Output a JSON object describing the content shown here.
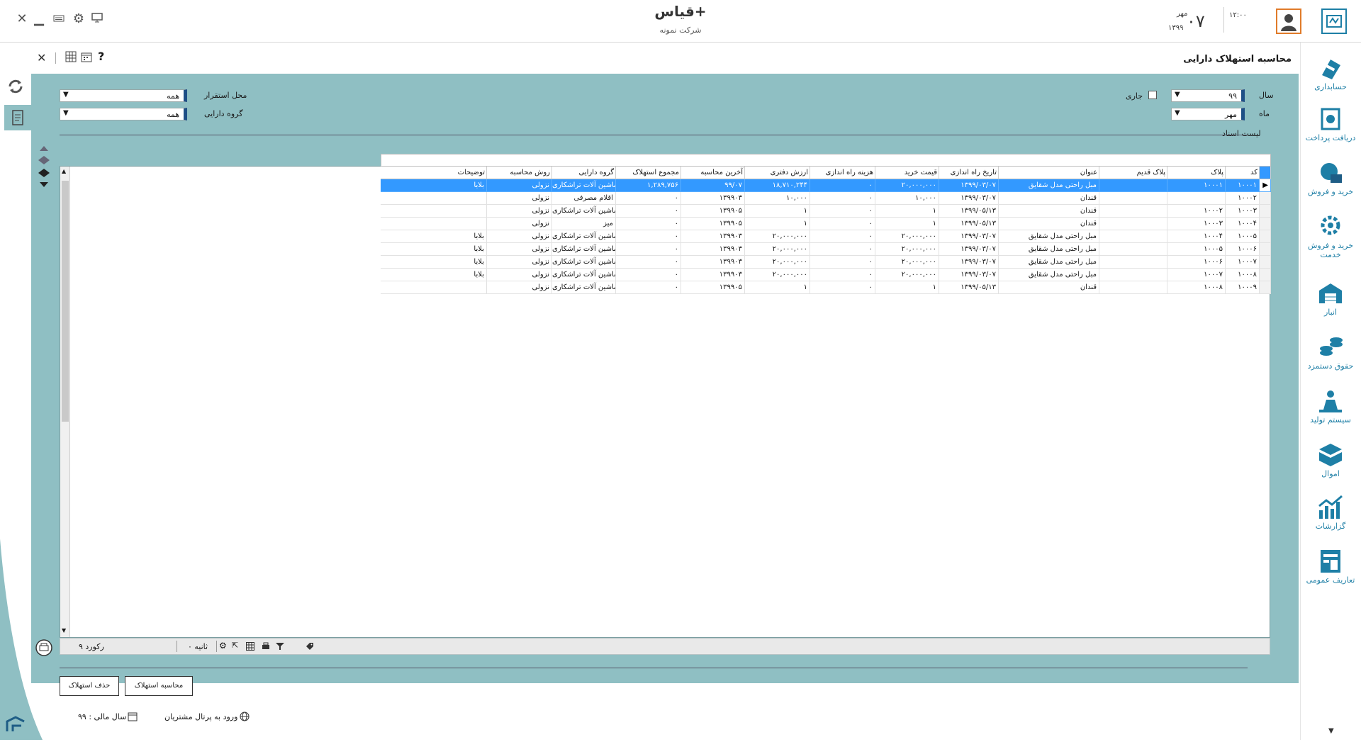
{
  "header": {
    "app_title": "قیاس+",
    "company": "شرکت نمونه",
    "time": "۱۲:۰۰",
    "day": "۰۷",
    "month": "مهر",
    "year": "۱۳۹۹"
  },
  "page": {
    "title": "محاسبه استهلاک دارایی",
    "help": "?"
  },
  "filters": {
    "year_label": "سال",
    "year_value": "۹۹",
    "current_label": "جاری",
    "month_label": "ماه",
    "month_value": "مهر",
    "location_label": "محل استقرار",
    "location_value": "همه",
    "group_label": "گروه دارایی",
    "group_value": "همه",
    "list_title": "لیست اسناد"
  },
  "nav": [
    {
      "label": "حسابداری",
      "icon": "accounting-icon"
    },
    {
      "label": "دریافت پرداخت",
      "icon": "payment-icon"
    },
    {
      "label": "خرید و فروش",
      "icon": "sales-icon"
    },
    {
      "label": "خرید و فروش خدمت",
      "icon": "service-icon"
    },
    {
      "label": "انبار",
      "icon": "warehouse-icon"
    },
    {
      "label": "حقوق دستمزد",
      "icon": "payroll-icon"
    },
    {
      "label": "سیستم تولید",
      "icon": "production-icon"
    },
    {
      "label": "اموال",
      "icon": "assets-icon"
    },
    {
      "label": "گزارشات",
      "icon": "reports-icon"
    },
    {
      "label": "تعاریف عمومی",
      "icon": "definitions-icon"
    }
  ],
  "table": {
    "columns": [
      "کد",
      "پلاک",
      "پلاک قدیم",
      "عنوان",
      "تاریخ راه اندازی",
      "قیمت خرید",
      "هزینه راه اندازی",
      "ارزش دفتری",
      "آخرین محاسبه",
      "مجموع استهلاک",
      "گروه دارایی",
      "روش محاسبه",
      "توضیحات"
    ],
    "rows": [
      [
        "۱۰۰۰۱",
        "۱۰۰۰۱",
        "",
        "مبل راحتی مدل شقایق",
        "۱۳۹۹/۰۳/۰۷",
        "۲۰,۰۰۰,۰۰۰",
        "۰",
        "۱۸,۷۱۰,۲۴۴",
        "۹۹/۰۷",
        "۱,۲۸۹,۷۵۶",
        "ماشین آلات تراشکاری",
        "نزولی",
        "بلابا"
      ],
      [
        "۱۰۰۰۲",
        "",
        "",
        "قندان",
        "۱۳۹۹/۰۳/۰۷",
        "۱۰,۰۰۰",
        "۰",
        "۱۰,۰۰۰",
        "۱۳۹۹۰۳",
        "۰",
        "اقلام مصرفی",
        "نزولی",
        ""
      ],
      [
        "۱۰۰۰۳",
        "۱۰۰۰۲",
        "",
        "قندان",
        "۱۳۹۹/۰۵/۱۳",
        "۱",
        "۰",
        "۱",
        "۱۳۹۹۰۵",
        "۰",
        "ماشین آلات تراشکاری",
        "نزولی",
        ""
      ],
      [
        "۱۰۰۰۴",
        "۱۰۰۰۳",
        "",
        "قندان",
        "۱۳۹۹/۰۵/۱۳",
        "۱",
        "۰",
        "۱",
        "۱۳۹۹۰۵",
        "۰",
        "میز",
        "نزولی",
        ""
      ],
      [
        "۱۰۰۰۵",
        "۱۰۰۰۴",
        "",
        "مبل راحتی مدل شقایق",
        "۱۳۹۹/۰۳/۰۷",
        "۲۰,۰۰۰,۰۰۰",
        "۰",
        "۲۰,۰۰۰,۰۰۰",
        "۱۳۹۹۰۳",
        "۰",
        "ماشین آلات تراشکاری",
        "نزولی",
        "بلابا"
      ],
      [
        "۱۰۰۰۶",
        "۱۰۰۰۵",
        "",
        "مبل راحتی مدل شقایق",
        "۱۳۹۹/۰۳/۰۷",
        "۲۰,۰۰۰,۰۰۰",
        "۰",
        "۲۰,۰۰۰,۰۰۰",
        "۱۳۹۹۰۳",
        "۰",
        "ماشین آلات تراشکاری",
        "نزولی",
        "بلابا"
      ],
      [
        "۱۰۰۰۷",
        "۱۰۰۰۶",
        "",
        "مبل راحتی مدل شقایق",
        "۱۳۹۹/۰۳/۰۷",
        "۲۰,۰۰۰,۰۰۰",
        "۰",
        "۲۰,۰۰۰,۰۰۰",
        "۱۳۹۹۰۳",
        "۰",
        "ماشین آلات تراشکاری",
        "نزولی",
        "بلابا"
      ],
      [
        "۱۰۰۰۸",
        "۱۰۰۰۷",
        "",
        "مبل راحتی مدل شقایق",
        "۱۳۹۹/۰۳/۰۷",
        "۲۰,۰۰۰,۰۰۰",
        "۰",
        "۲۰,۰۰۰,۰۰۰",
        "۱۳۹۹۰۳",
        "۰",
        "ماشین آلات تراشکاری",
        "نزولی",
        "بلابا"
      ],
      [
        "۱۰۰۰۹",
        "۱۰۰۰۸",
        "",
        "قندان",
        "۱۳۹۹/۰۵/۱۳",
        "۱",
        "۰",
        "۱",
        "۱۳۹۹۰۵",
        "۰",
        "ماشین آلات تراشکاری",
        "نزولی",
        ""
      ]
    ]
  },
  "footer": {
    "records": "۹ رکورد",
    "seconds": "۰ ثانیه"
  },
  "buttons": {
    "calc": "محاسبه استهلاک",
    "delete": "حذف استهلاک"
  },
  "status": {
    "fiscal_year": "سال مالی : ۹۹",
    "portal": "ورود به پرتال مشتریان"
  },
  "colors": {
    "panel": "#8fbfc3",
    "accent": "#1e7fa6",
    "selection": "#3399ff"
  }
}
